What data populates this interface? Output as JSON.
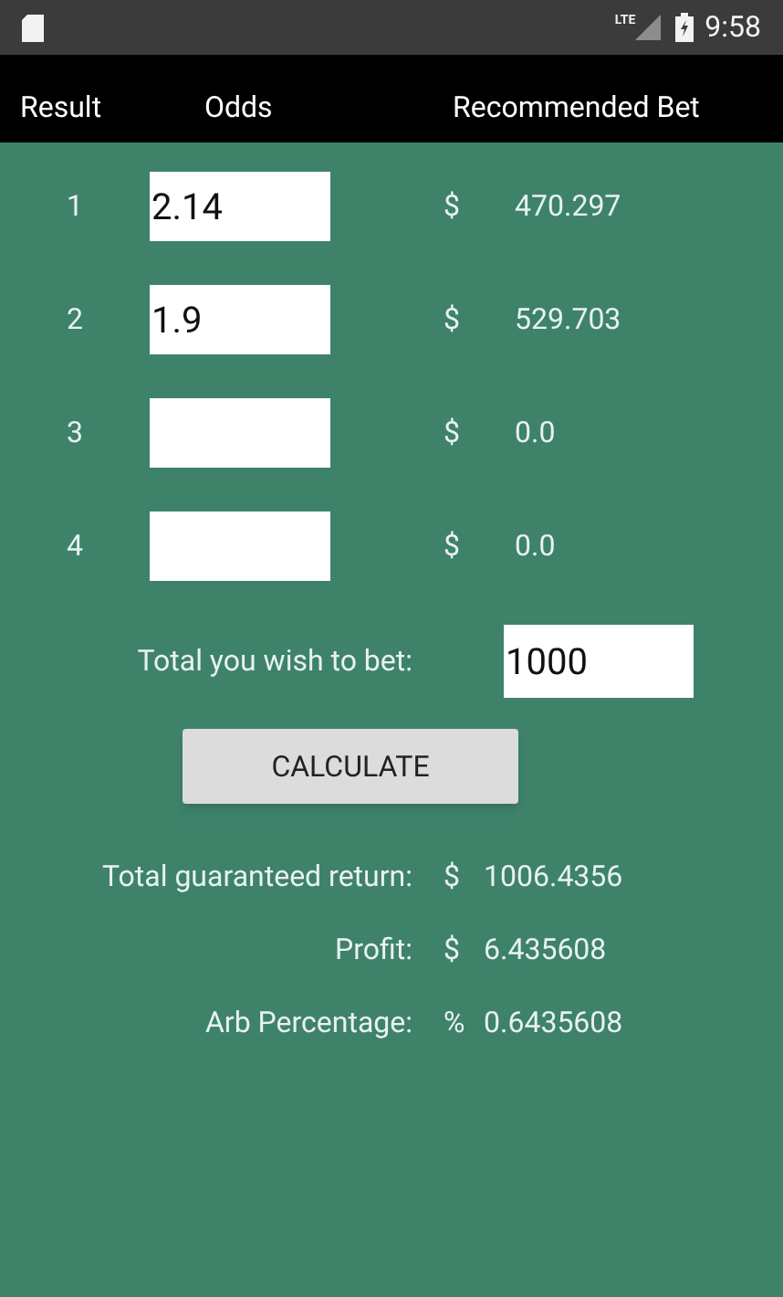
{
  "status_bar": {
    "network_label": "LTE",
    "time": "9:58"
  },
  "header": {
    "columns": [
      "Result",
      "Odds",
      "Recommended Bet"
    ]
  },
  "results": [
    {
      "number": "1",
      "odds": "2.14",
      "currency": "$",
      "bet": "470.297"
    },
    {
      "number": "2",
      "odds": "1.9",
      "currency": "$",
      "bet": "529.703"
    },
    {
      "number": "3",
      "currency": "$",
      "bet": "0.0"
    },
    {
      "number": "4",
      "currency": "$",
      "bet": "0.0"
    }
  ],
  "total_bet": {
    "label": "Total you wish to bet:",
    "value": "1000"
  },
  "calculate_button": "CALCULATE",
  "summary": [
    {
      "label": "Total guaranteed return:",
      "symbol": "$",
      "value": "1006.4356"
    },
    {
      "label": "Profit:",
      "symbol": "$",
      "value": "6.435608"
    },
    {
      "label": "Arb Percentage:",
      "symbol": "%",
      "value": "0.6435608"
    }
  ]
}
